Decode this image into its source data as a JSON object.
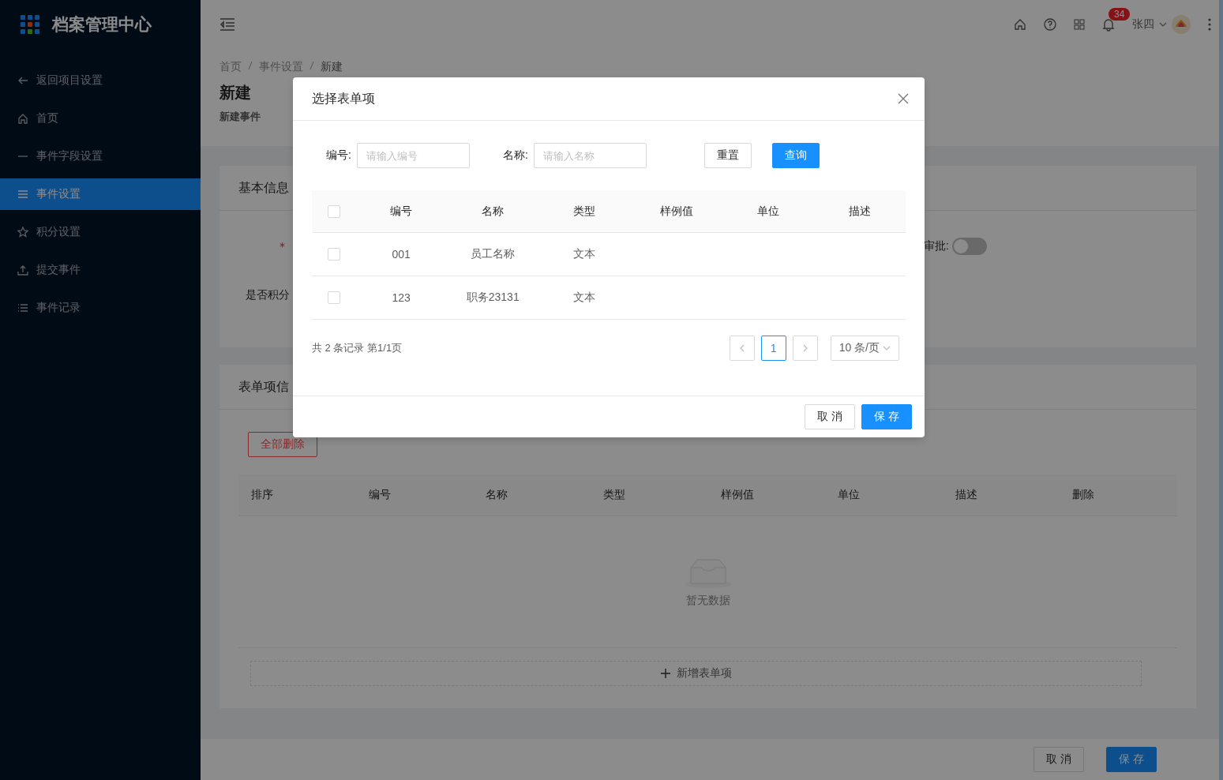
{
  "sidebar": {
    "logo": "档案管理中心",
    "items": [
      {
        "label": "返回项目设置",
        "selected": false
      },
      {
        "label": "首页",
        "selected": false
      },
      {
        "label": "事件字段设置",
        "selected": false
      },
      {
        "label": "事件设置",
        "selected": true
      },
      {
        "label": "积分设置",
        "selected": false
      },
      {
        "label": "提交事件",
        "selected": false
      },
      {
        "label": "事件记录",
        "selected": false
      }
    ]
  },
  "header": {
    "notifications": "34",
    "user": "张四"
  },
  "breadcrumb": [
    "首页",
    "事件设置",
    "新建"
  ],
  "page": {
    "title": "新建",
    "subtitle": "新建事件"
  },
  "basic_info": {
    "title": "基本信息",
    "required_mark": "*",
    "field_label": "是否积分",
    "approval_label": "审批:",
    "approval_on": false
  },
  "form_items": {
    "title": "表单项信",
    "delete_all": "全部删除",
    "columns": [
      "排序",
      "编号",
      "名称",
      "类型",
      "样例值",
      "单位",
      "描述",
      "删除"
    ],
    "empty_text": "暂无数据",
    "add_button": "新增表单项"
  },
  "footer": {
    "buttons": [
      {
        "label": "取 消",
        "kind": "default"
      },
      {
        "label": "保 存",
        "kind": "primary"
      }
    ]
  },
  "dialog": {
    "title": "选择表单项",
    "filters": [
      {
        "label": "编号:",
        "placeholder": "请输入编号"
      },
      {
        "label": "名称:",
        "placeholder": "请输入名称"
      }
    ],
    "buttons": [
      {
        "label": "重置",
        "kind": "default"
      },
      {
        "label": "查询",
        "kind": "primary"
      }
    ],
    "columns": [
      "编号",
      "名称",
      "类型",
      "样例值",
      "单位",
      "描述"
    ],
    "header_checked": false,
    "rows": [
      {
        "checked": false,
        "cells": [
          "001",
          "员工名称",
          "文本"
        ]
      },
      {
        "checked": false,
        "cells": [
          "123",
          "职务23131",
          "文本"
        ]
      }
    ],
    "summary": "共 2 条记录 第1/1页",
    "pages": [
      {
        "label": "1",
        "selected": true
      }
    ],
    "page_size": "10 条/页",
    "footer_buttons": [
      {
        "label": "取 消",
        "kind": "default"
      },
      {
        "label": "保 存",
        "kind": "primary"
      }
    ]
  }
}
